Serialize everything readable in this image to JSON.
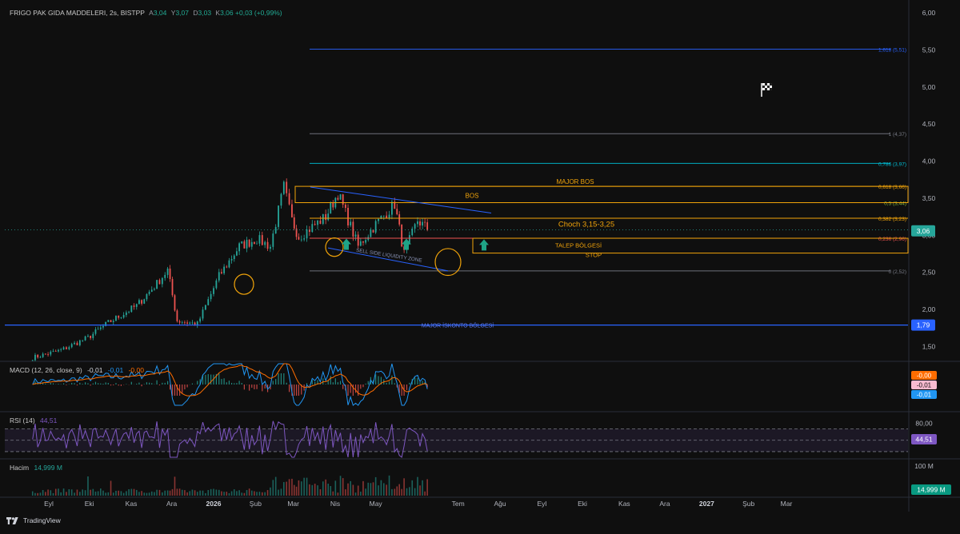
{
  "header": {
    "symbol": "FRIGO PAK GIDA MADDELERI, 2s, BISTPP",
    "open_label": "A",
    "open": "3,04",
    "high_label": "Y",
    "high": "3,07",
    "low_label": "D",
    "low": "3,03",
    "close_label": "K",
    "close": "3,06",
    "change": "+0,03 (+0,99%)"
  },
  "colors": {
    "background": "#0f0f0f",
    "up": "#26a69a",
    "down": "#ef5350",
    "orange": "#f0a30a",
    "blue": "#2962ff",
    "macd": "#2196f3",
    "signal": "#ff6d00",
    "rsi": "#7e57c2"
  },
  "chart_data": [
    {
      "type": "candlestick",
      "panel": "price",
      "ylim": [
        1.3,
        6.1
      ],
      "y_ticks": [
        "6,00",
        "5,50",
        "5,00",
        "4,50",
        "4,00",
        "3,50",
        "3,00",
        "2,50",
        "2,00",
        "1,50"
      ],
      "x_ticks": [
        "Eyl",
        "Eki",
        "Kas",
        "Ara",
        "2026",
        "Şub",
        "Mar",
        "Nis",
        "May",
        "Tem",
        "Ağu",
        "Eyl",
        "Eki",
        "Kas",
        "Ara",
        "2027",
        "Şub",
        "Mar"
      ],
      "price_path": [
        {
          "date": "2025-08-20",
          "value": 1.35
        },
        {
          "date": "2025-09-10",
          "value": 1.45
        },
        {
          "date": "2025-09-30",
          "value": 1.62
        },
        {
          "date": "2025-10-15",
          "value": 1.82
        },
        {
          "date": "2025-11-05",
          "value": 2.05
        },
        {
          "date": "2025-11-20",
          "value": 2.35
        },
        {
          "date": "2025-11-28",
          "value": 2.53
        },
        {
          "date": "2025-12-05",
          "value": 1.85
        },
        {
          "date": "2025-12-20",
          "value": 1.8
        },
        {
          "date": "2026-01-05",
          "value": 2.45
        },
        {
          "date": "2026-01-20",
          "value": 2.85
        },
        {
          "date": "2026-02-02",
          "value": 2.95
        },
        {
          "date": "2026-02-12",
          "value": 2.85
        },
        {
          "date": "2026-02-22",
          "value": 3.65
        },
        {
          "date": "2026-02-28",
          "value": 3.2
        },
        {
          "date": "2026-03-05",
          "value": 2.98
        },
        {
          "date": "2026-03-25",
          "value": 3.25
        },
        {
          "date": "2026-04-03",
          "value": 3.57
        },
        {
          "date": "2026-04-18",
          "value": 2.85
        },
        {
          "date": "2026-05-01",
          "value": 3.15
        },
        {
          "date": "2026-05-15",
          "value": 3.42
        },
        {
          "date": "2026-05-22",
          "value": 2.75
        },
        {
          "date": "2026-06-01",
          "value": 3.2
        },
        {
          "date": "2026-06-10",
          "value": 3.06
        }
      ],
      "fib_levels": [
        {
          "label": "1,618 (5,51)",
          "value": 5.51,
          "color": "#2962ff"
        },
        {
          "label": "1 (4,37)",
          "value": 4.37,
          "color": "#787b86"
        },
        {
          "label": "0,786 (3,97)",
          "value": 3.97,
          "color": "#00bcd4"
        },
        {
          "label": "0,618 (3,66)",
          "value": 3.66,
          "color": "#f0a30a"
        },
        {
          "label": "0,5 (3,44)",
          "value": 3.44,
          "color": "#7cb342"
        },
        {
          "label": "0,382 (3,23)",
          "value": 3.23,
          "color": "#f0a30a"
        },
        {
          "label": "0,236 (2,96)",
          "value": 2.96,
          "color": "#ef5350"
        },
        {
          "label": "0 (2,52)",
          "value": 2.52,
          "color": "#787b86"
        }
      ],
      "annotations": [
        "MAJOR BOS",
        "BOS",
        "Choch 3,15-3,25",
        "TALEP BÖLGESİ",
        "STOP",
        "SELL SIDE LIQUIDITY ZONE",
        "MAJOR İSKONTO BÖLGESİ"
      ],
      "price_badges": [
        {
          "text": "3,06",
          "value": 3.06,
          "color": "#26a69a"
        },
        {
          "text": "1,79",
          "value": 1.79,
          "color": "#2962ff"
        }
      ]
    },
    {
      "type": "line",
      "panel": "macd",
      "title": "MACD (12, 26, close, 9)",
      "values_text": [
        "-0,01",
        "-0,01",
        "-0,00"
      ],
      "badges": [
        {
          "text": "-0,00",
          "color": "#ff6d00"
        },
        {
          "text": "-0,01",
          "color": "#f8bbd0"
        },
        {
          "text": "-0,01",
          "color": "#2196f3"
        }
      ]
    },
    {
      "type": "line",
      "panel": "rsi",
      "title": "RSI (14)",
      "value_text": "44,51",
      "ylim": [
        15,
        90
      ],
      "levels": [
        70,
        50,
        30
      ],
      "y_ticks": [
        "80,00"
      ],
      "badge": "44,51"
    },
    {
      "type": "bar",
      "panel": "volume",
      "title": "Hacim",
      "value_text": "14,999 M",
      "y_ticks": [
        "100 M"
      ],
      "badge": "14,999 M"
    }
  ],
  "footer": {
    "brand": "TradingView"
  }
}
